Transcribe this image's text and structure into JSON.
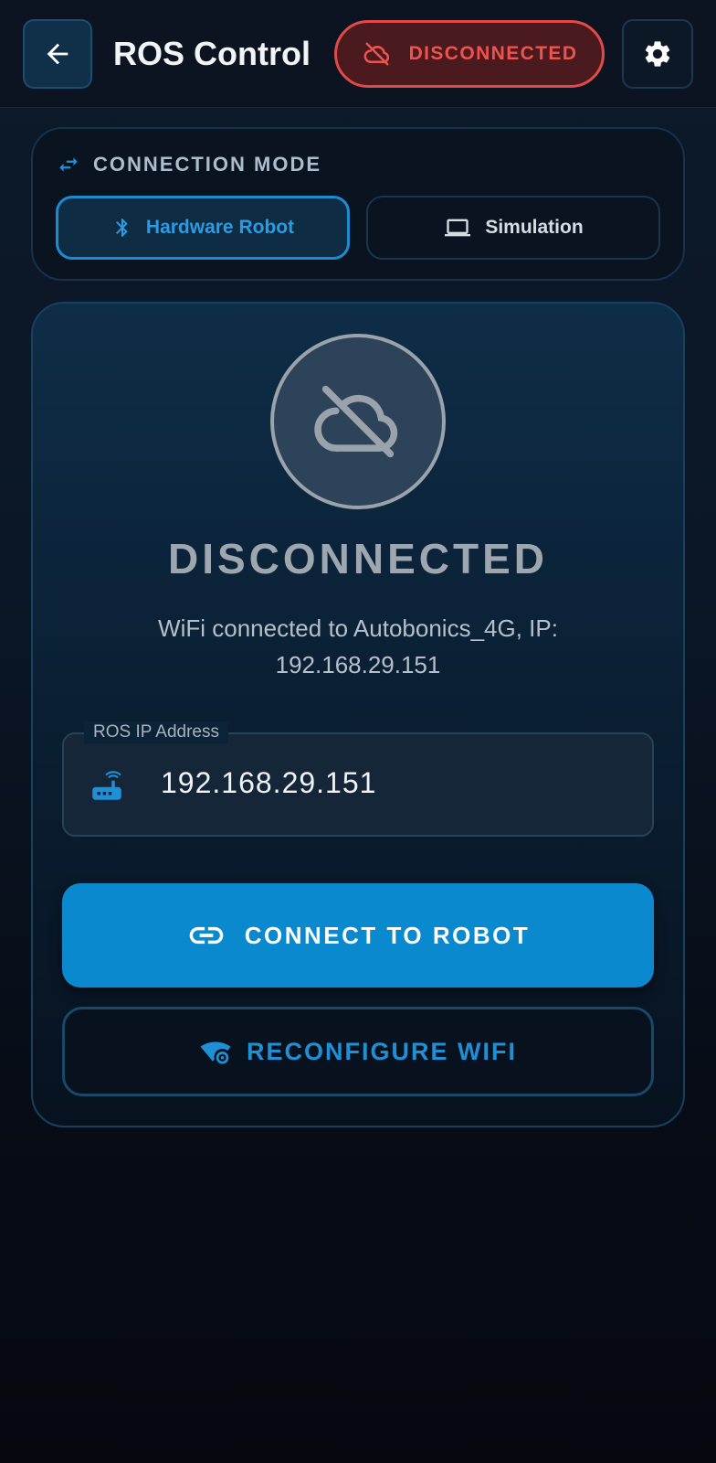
{
  "app": {
    "title": "ROS Control",
    "connection_status": "DISCONNECTED"
  },
  "icons": {
    "back": "arrow-left-icon",
    "status": "cloud-off-icon",
    "settings": "gear-icon",
    "mode_header": "swap-horizontal-icon",
    "hardware": "bluetooth-icon",
    "simulation": "laptop-icon",
    "status_large": "cloud-off-icon",
    "ip_field": "router-icon",
    "connect": "link-icon",
    "wifi": "wifi-settings-icon"
  },
  "connection_mode": {
    "header": "CONNECTION MODE",
    "options": [
      {
        "label": "Hardware Robot",
        "selected": true
      },
      {
        "label": "Simulation",
        "selected": false
      }
    ]
  },
  "status_panel": {
    "status_text": "DISCONNECTED",
    "wifi_info": "WiFi connected to Autobonics_4G, IP: 192.168.29.151"
  },
  "ip_field": {
    "label": "ROS IP Address",
    "value": "192.168.29.151"
  },
  "actions": {
    "connect_label": "CONNECT TO ROBOT",
    "reconfigure_label": "RECONFIGURE WIFI"
  },
  "colors": {
    "accent": "#0a89cf",
    "error": "#ef5350",
    "muted_status": "#9ea7b0"
  }
}
